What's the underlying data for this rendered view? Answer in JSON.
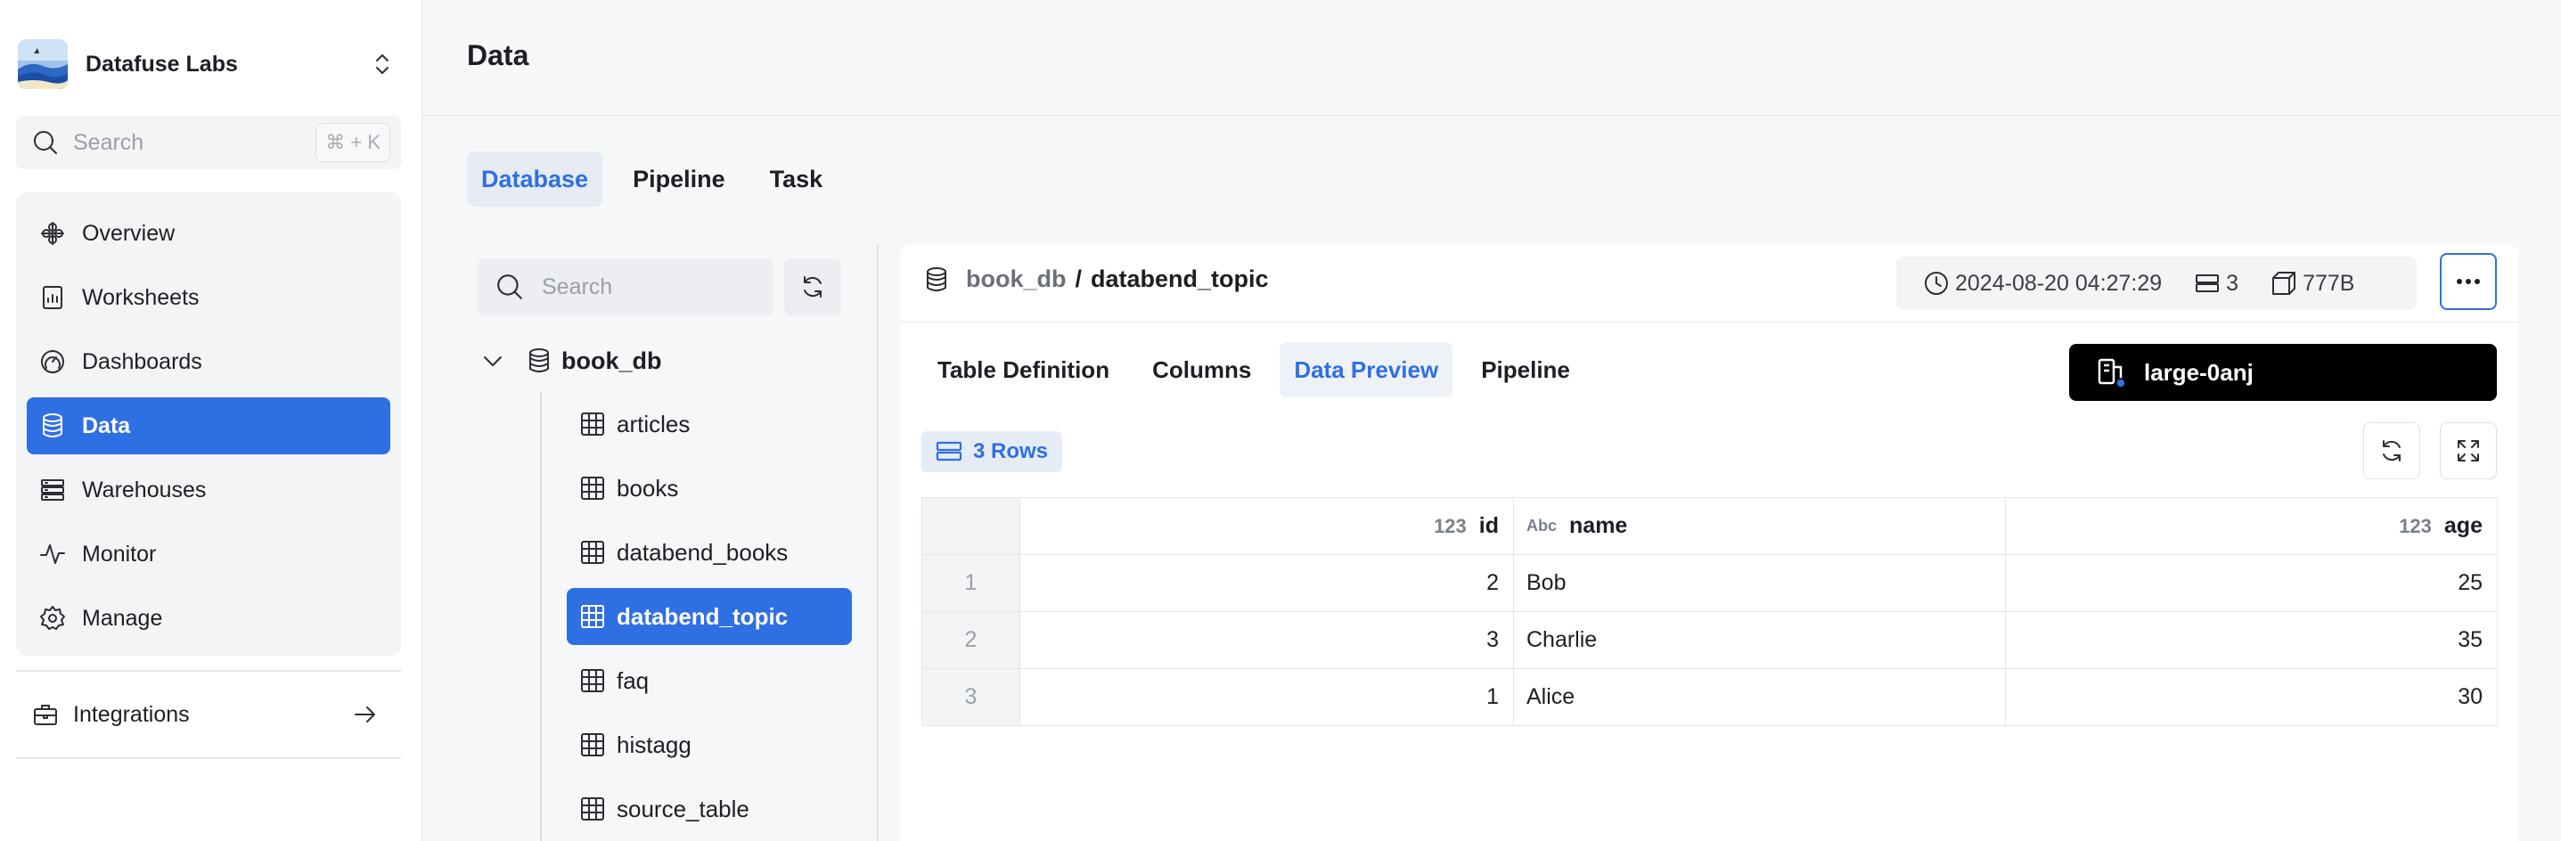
{
  "org": {
    "name": "Datafuse Labs"
  },
  "sidebar": {
    "search_placeholder": "Search",
    "search_shortcut": "⌘ + K",
    "items": [
      {
        "label": "Overview",
        "icon": "overview-icon"
      },
      {
        "label": "Worksheets",
        "icon": "worksheet-icon"
      },
      {
        "label": "Dashboards",
        "icon": "dashboard-icon"
      },
      {
        "label": "Data",
        "icon": "database-icon",
        "active": true
      },
      {
        "label": "Warehouses",
        "icon": "server-icon"
      },
      {
        "label": "Monitor",
        "icon": "activity-icon"
      },
      {
        "label": "Manage",
        "icon": "gear-icon"
      }
    ],
    "integrations_label": "Integrations"
  },
  "header": {
    "title": "Data"
  },
  "top_tabs": [
    {
      "label": "Database",
      "active": true
    },
    {
      "label": "Pipeline"
    },
    {
      "label": "Task"
    }
  ],
  "tree": {
    "search_placeholder": "Search",
    "database": "book_db",
    "tables": [
      "articles",
      "books",
      "databend_books",
      "databend_topic",
      "faq",
      "histagg",
      "source_table"
    ],
    "active_table": "databend_topic"
  },
  "panel": {
    "breadcrumb_db": "book_db",
    "breadcrumb_sep": "/",
    "breadcrumb_table": "databend_topic",
    "updated_at": "2024-08-20 04:27:29",
    "row_count": "3",
    "size": "777B",
    "subtabs": [
      {
        "label": "Table Definition"
      },
      {
        "label": "Columns"
      },
      {
        "label": "Data Preview",
        "active": true
      },
      {
        "label": "Pipeline"
      }
    ],
    "warehouse": "large-0anj",
    "rows_badge": "3 Rows"
  },
  "table": {
    "columns": [
      {
        "type": "123",
        "name": "id",
        "align": "right"
      },
      {
        "type": "Abc",
        "name": "name",
        "align": "left"
      },
      {
        "type": "123",
        "name": "age",
        "align": "right"
      }
    ],
    "rows": [
      {
        "idx": "1",
        "id": "2",
        "name": "Bob",
        "age": "25"
      },
      {
        "idx": "2",
        "id": "3",
        "name": "Charlie",
        "age": "35"
      },
      {
        "idx": "3",
        "id": "1",
        "name": "Alice",
        "age": "30"
      }
    ]
  },
  "colors": {
    "accent": "#2f6fe4",
    "warehouse_bg": "#000000",
    "status_dot": "#2f6fe4"
  }
}
